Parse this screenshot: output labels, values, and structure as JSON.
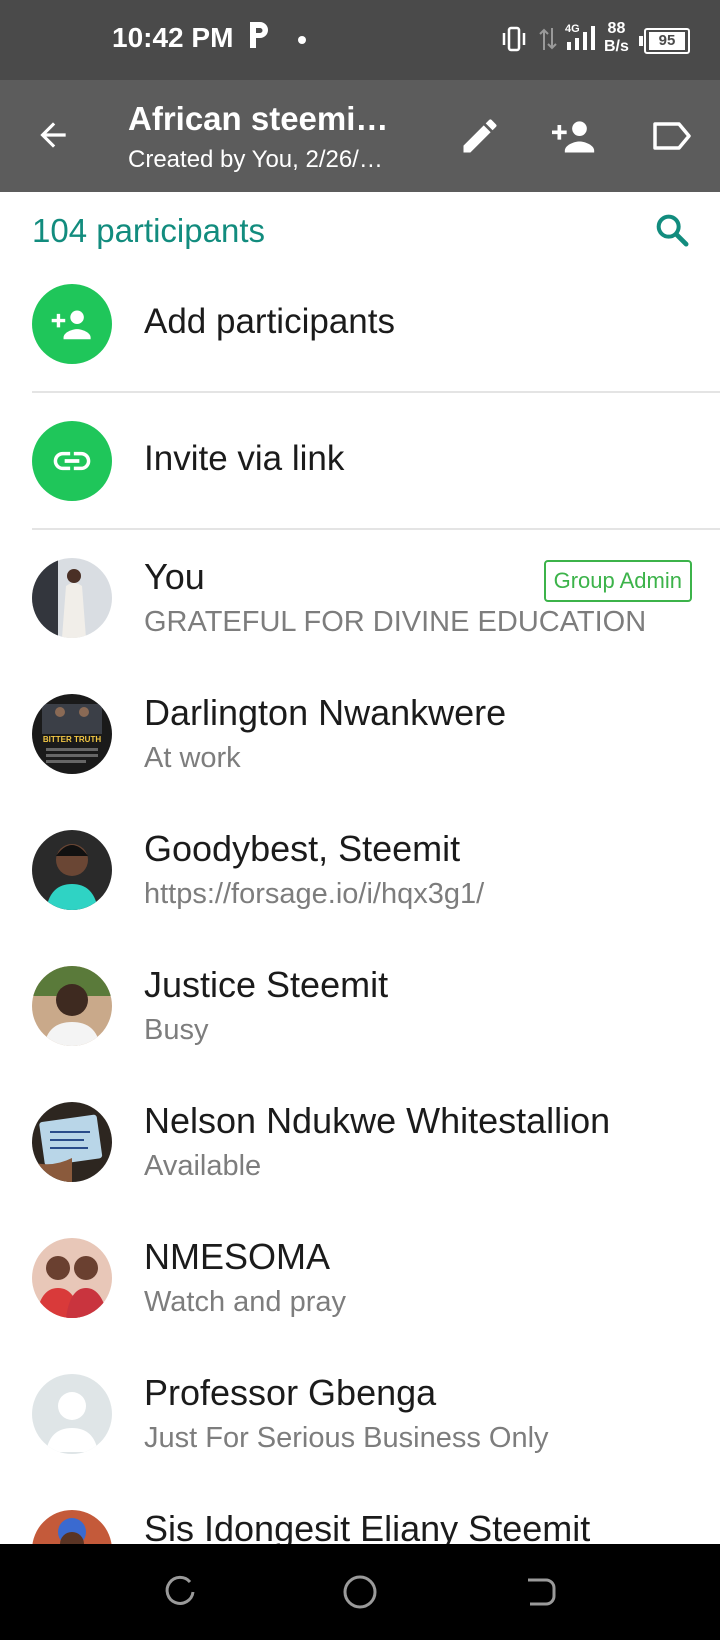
{
  "status_bar": {
    "time": "10:42 PM",
    "network_type": "4G",
    "data_rate_value": "88",
    "data_rate_unit": "B/s",
    "battery": "95"
  },
  "app_bar": {
    "title": "African steemi…",
    "subtitle": "Created by You, 2/26/…"
  },
  "participants": {
    "count_label": "104 participants"
  },
  "actions": [
    {
      "label": "Add participants",
      "icon": "add-person-icon"
    },
    {
      "label": "Invite via link",
      "icon": "link-icon"
    }
  ],
  "members": [
    {
      "name": "You",
      "status": "GRATEFUL FOR DIVINE EDUCATION",
      "badge": "Group Admin"
    },
    {
      "name": "Darlington Nwankwere",
      "status": "At work",
      "avatar_text": "BITTER TRUTH"
    },
    {
      "name": "Goodybest, Steemit",
      "status": "https://forsage.io/i/hqx3g1/"
    },
    {
      "name": "Justice Steemit",
      "status": "Busy"
    },
    {
      "name": "Nelson Ndukwe Whitestallion",
      "status": "Available"
    },
    {
      "name": "NMESOMA",
      "status": "Watch and pray"
    },
    {
      "name": "Professor Gbenga",
      "status": "Just For Serious Business Only"
    },
    {
      "name": "Sis Idongesit Eliany Steemit",
      "status": ""
    }
  ],
  "colors": {
    "accent": "#128c7e",
    "action_green": "#1fc65a",
    "admin_green": "#3cb34a",
    "app_bar": "#5c5c5c",
    "status_bar": "#4a4a4a"
  }
}
